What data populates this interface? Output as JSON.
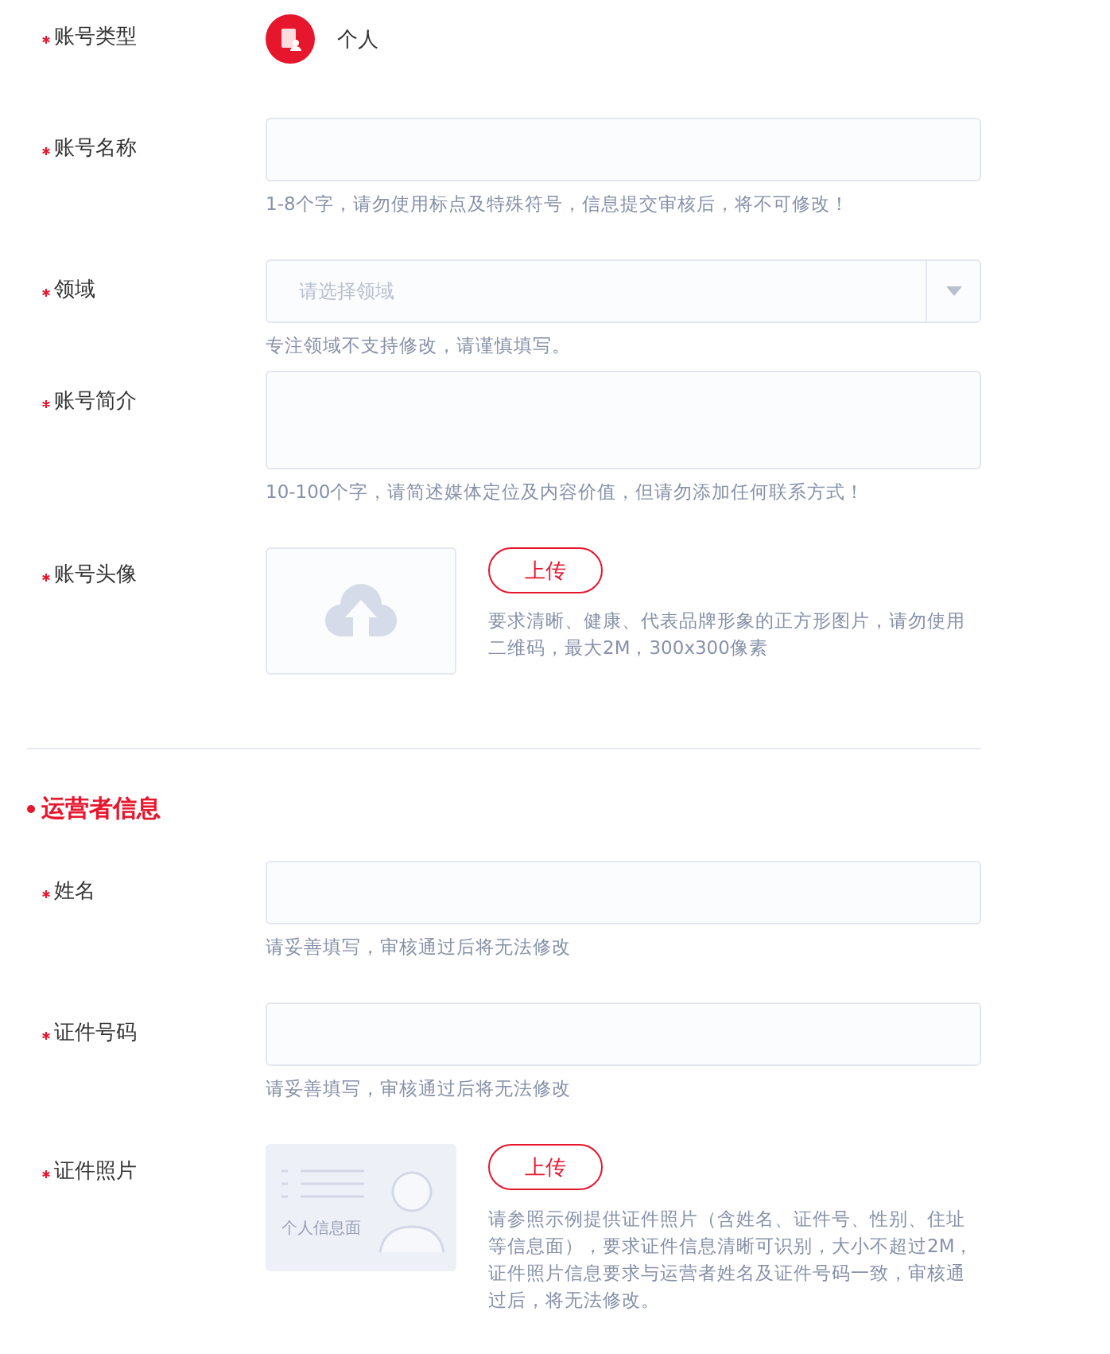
{
  "account_fields": [
    {
      "kind": "type",
      "label": "账号类型",
      "required": true,
      "value": "个人"
    },
    {
      "kind": "input",
      "label": "账号名称",
      "required": true,
      "hint": "1-8个字，请勿使用标点及特殊符号，信息提交审核后，将不可修改！"
    },
    {
      "kind": "select",
      "label": "领域",
      "required": true,
      "placeholder": "请选择领域",
      "hint": "专注领域不支持修改，请谨慎填写。"
    },
    {
      "kind": "textarea",
      "label": "账号简介",
      "required": true,
      "hint": "10-100个字，请简述媒体定位及内容价值，但请勿添加任何联系方式！"
    },
    {
      "kind": "upload",
      "label": "账号头像",
      "required": true,
      "button": "上传",
      "hint": "要求清晰、健康、代表品牌形象的正方形图片，请勿使用二维码，最大2M，300x300像素"
    }
  ],
  "operator_section": {
    "title": "运营者信息"
  },
  "operator_fields": [
    {
      "kind": "input",
      "label": "姓名",
      "required": true,
      "hint": "请妥善填写，审核通过后将无法修改"
    },
    {
      "kind": "input",
      "label": "证件号码",
      "required": true,
      "hint": "请妥善填写，审核通过后将无法修改"
    },
    {
      "kind": "idcard",
      "label": "证件照片",
      "required": true,
      "button": "上传",
      "caption": "个人信息面",
      "hint": "请参照示例提供证件照片（含姓名、证件号、性别、住址等信息面），要求证件信息清晰可识别，大小不超过2M，证件照片信息要求与运营者姓名及证件号码一致，审核通过后，将无法修改。"
    }
  ]
}
